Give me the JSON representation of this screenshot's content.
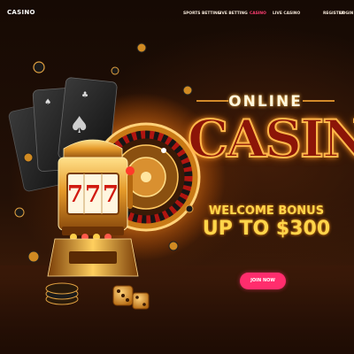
{
  "nav": {
    "logo": "CASINO",
    "links": [
      {
        "label": "SPORTS BETTING"
      },
      {
        "label": "LIVE BETTING"
      },
      {
        "label": "CASINO",
        "active": true
      },
      {
        "label": "LIVE CASINO"
      }
    ],
    "register": "REGISTER",
    "login": "LOGIN"
  },
  "hero": {
    "overline": "ONLINE",
    "title": "CASINO",
    "bonus_line1": "WELCOME BONUS",
    "bonus_line2": "UP TO $300",
    "cta_label": "JOIN NOW",
    "slot_reels": [
      "7",
      "7",
      "7"
    ]
  },
  "colors": {
    "accent": "#ff2d6d",
    "active_nav": "#ff3e73",
    "gold": "#ffd54a",
    "neon_red": "#8c1508"
  }
}
